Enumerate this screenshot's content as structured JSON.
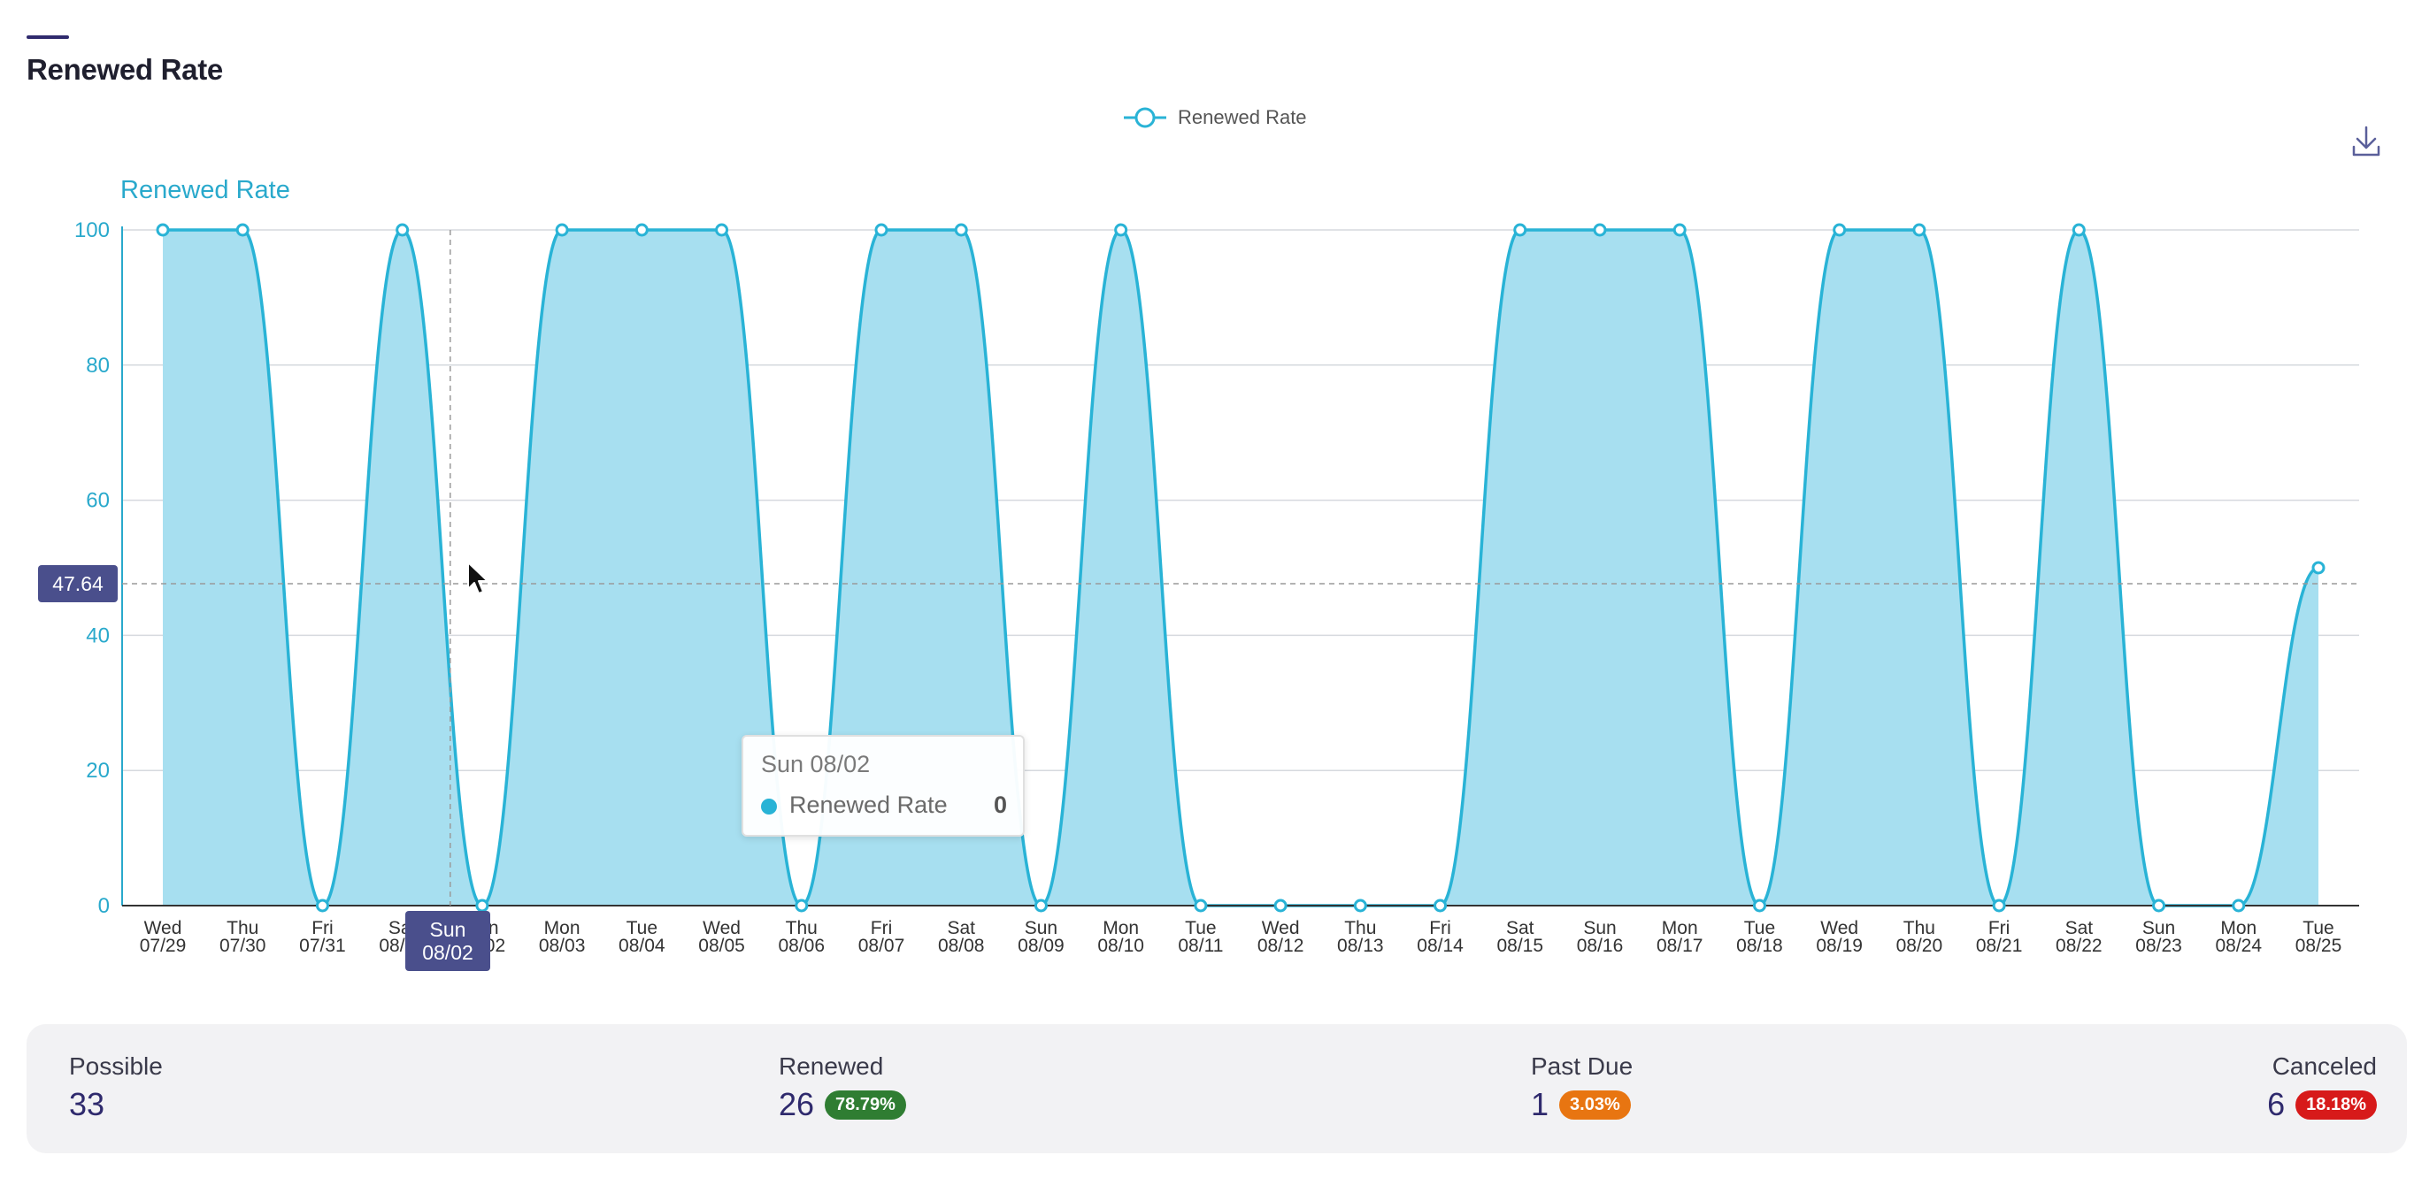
{
  "card": {
    "title": "Renewed Rate"
  },
  "colors": {
    "line": "#29b3d6",
    "fill": "#a7dff0",
    "accent": "#2f2a6d",
    "crosshair_label": "#4a4f8c",
    "badge_renewed": "#2f7d32",
    "badge_past_due": "#e87511",
    "badge_canceled": "#d71a1a"
  },
  "icons": {
    "download": "download-icon",
    "cursor": "mouse-pointer-icon"
  },
  "chart_data": {
    "type": "area",
    "ylabel": "Renewed Rate",
    "ylim": [
      0,
      100
    ],
    "yticks": [
      0,
      20,
      40,
      60,
      80,
      100
    ],
    "grid": true,
    "legend": {
      "placement": "top-center",
      "entries": [
        "Renewed Rate"
      ]
    },
    "x": [
      {
        "day": "Wed",
        "date": "07/29"
      },
      {
        "day": "Thu",
        "date": "07/30"
      },
      {
        "day": "Fri",
        "date": "07/31"
      },
      {
        "day": "Sat",
        "date": "08/01"
      },
      {
        "day": "Sun",
        "date": "08/02"
      },
      {
        "day": "Mon",
        "date": "08/03"
      },
      {
        "day": "Tue",
        "date": "08/04"
      },
      {
        "day": "Wed",
        "date": "08/05"
      },
      {
        "day": "Thu",
        "date": "08/06"
      },
      {
        "day": "Fri",
        "date": "08/07"
      },
      {
        "day": "Sat",
        "date": "08/08"
      },
      {
        "day": "Sun",
        "date": "08/09"
      },
      {
        "day": "Mon",
        "date": "08/10"
      },
      {
        "day": "Tue",
        "date": "08/11"
      },
      {
        "day": "Wed",
        "date": "08/12"
      },
      {
        "day": "Thu",
        "date": "08/13"
      },
      {
        "day": "Fri",
        "date": "08/14"
      },
      {
        "day": "Sat",
        "date": "08/15"
      },
      {
        "day": "Sun",
        "date": "08/16"
      },
      {
        "day": "Mon",
        "date": "08/17"
      },
      {
        "day": "Tue",
        "date": "08/18"
      },
      {
        "day": "Wed",
        "date": "08/19"
      },
      {
        "day": "Thu",
        "date": "08/20"
      },
      {
        "day": "Fri",
        "date": "08/21"
      },
      {
        "day": "Sat",
        "date": "08/22"
      },
      {
        "day": "Sun",
        "date": "08/23"
      },
      {
        "day": "Mon",
        "date": "08/24"
      },
      {
        "day": "Tue",
        "date": "08/25"
      }
    ],
    "series": [
      {
        "name": "Renewed Rate",
        "values": [
          100,
          100,
          0,
          100,
          0,
          100,
          100,
          100,
          0,
          100,
          100,
          0,
          100,
          0,
          0,
          0,
          0,
          100,
          100,
          100,
          0,
          100,
          100,
          0,
          100,
          0,
          0,
          50
        ]
      }
    ]
  },
  "tooltip": {
    "title": "Sun 08/02",
    "series": "Renewed Rate",
    "value": "0"
  },
  "crosshair": {
    "y_value": "47.64",
    "x_day": "Sun",
    "x_date": "08/02",
    "x_index": 3.6
  },
  "stats": {
    "possible": {
      "label": "Possible",
      "value": "33"
    },
    "renewed": {
      "label": "Renewed",
      "value": "26",
      "badge": "78.79%"
    },
    "past_due": {
      "label": "Past Due",
      "value": "1",
      "badge": "3.03%"
    },
    "canceled": {
      "label": "Canceled",
      "value": "6",
      "badge": "18.18%"
    }
  }
}
